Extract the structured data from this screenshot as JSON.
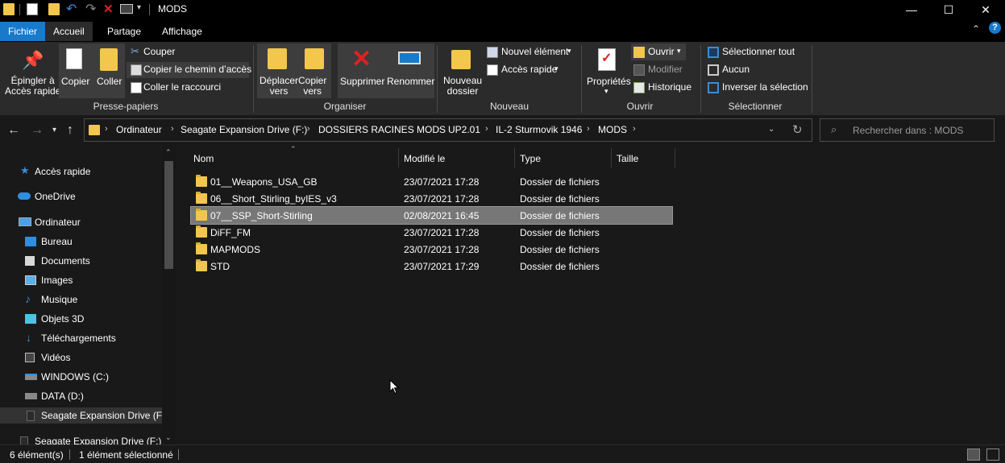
{
  "window": {
    "title": "MODS",
    "minimize": "—",
    "maximize": "☐",
    "close": "✕"
  },
  "tabs": [
    {
      "label": "Fichier"
    },
    {
      "label": "Accueil"
    },
    {
      "label": "Partage"
    },
    {
      "label": "Affichage"
    }
  ],
  "ribbon": {
    "presse_papiers": {
      "label": "Presse-papiers",
      "epingler": "Épingler à\nAccès rapide",
      "copier": "Copier",
      "coller": "Coller",
      "couper": "Couper",
      "copier_chemin": "Copier le chemin d’accès",
      "coller_raccourci": "Coller le raccourci"
    },
    "organiser": {
      "label": "Organiser",
      "deplacer": "Déplacer\nvers",
      "copier_vers": "Copier\nvers",
      "supprimer": "Supprimer",
      "renommer": "Renommer"
    },
    "nouveau": {
      "label": "Nouveau",
      "nouveau_dossier": "Nouveau\ndossier",
      "nouvel_element": "Nouvel élément",
      "acces_rapide": "Accès rapide"
    },
    "ouvrir": {
      "label": "Ouvrir",
      "proprietes": "Propriétés",
      "ouvrir": "Ouvrir",
      "modifier": "Modifier",
      "historique": "Historique"
    },
    "selectionner": {
      "label": "Sélectionner",
      "tout": "Sélectionner tout",
      "aucun": "Aucun",
      "inverser": "Inverser la sélection"
    }
  },
  "address": {
    "crumbs": [
      "Ordinateur",
      "Seagate Expansion Drive (F:)",
      "DOSSIERS RACINES MODS",
      "UP2.01",
      "IL-2 Sturmovik 1946",
      "MODS"
    ],
    "search_placeholder": "Rechercher dans : MODS"
  },
  "navpane": {
    "items": [
      {
        "label": "Accès rapide",
        "icon": "star-icon"
      },
      {
        "label": "OneDrive",
        "icon": "cloud-icon"
      },
      {
        "label": "Ordinateur",
        "icon": "computer-icon"
      },
      {
        "label": "Bureau",
        "icon": "desktop-icon"
      },
      {
        "label": "Documents",
        "icon": "documents-icon"
      },
      {
        "label": "Images",
        "icon": "images-icon"
      },
      {
        "label": "Musique",
        "icon": "music-icon"
      },
      {
        "label": "Objets 3D",
        "icon": "cube-icon"
      },
      {
        "label": "Téléchargements",
        "icon": "download-icon"
      },
      {
        "label": "Vidéos",
        "icon": "video-icon"
      },
      {
        "label": "WINDOWS (C:)",
        "icon": "windows-drive-icon"
      },
      {
        "label": "DATA (D:)",
        "icon": "drive-icon"
      },
      {
        "label": "Seagate Expansion Drive (F:)",
        "icon": "external-drive-icon"
      },
      {
        "label": "Seagate Expansion Drive (F:)",
        "icon": "external-drive-icon"
      }
    ]
  },
  "filelist": {
    "columns": [
      "Nom",
      "Modifié le",
      "Type",
      "Taille"
    ],
    "rows": [
      {
        "name": "01__Weapons_USA_GB",
        "date": "23/07/2021 17:28",
        "type": "Dossier de fichiers",
        "size": ""
      },
      {
        "name": "06__Short_Stirling_byIES_v3",
        "date": "23/07/2021 17:28",
        "type": "Dossier de fichiers",
        "size": ""
      },
      {
        "name": "07__SSP_Short-Stirling",
        "date": "02/08/2021 16:45",
        "type": "Dossier de fichiers",
        "size": ""
      },
      {
        "name": "DiFF_FM",
        "date": "23/07/2021 17:28",
        "type": "Dossier de fichiers",
        "size": ""
      },
      {
        "name": "MAPMODS",
        "date": "23/07/2021 17:28",
        "type": "Dossier de fichiers",
        "size": ""
      },
      {
        "name": "STD",
        "date": "23/07/2021 17:29",
        "type": "Dossier de fichiers",
        "size": ""
      }
    ]
  },
  "status": {
    "count": "6 élément(s)",
    "selected": "1 élément sélectionné"
  }
}
